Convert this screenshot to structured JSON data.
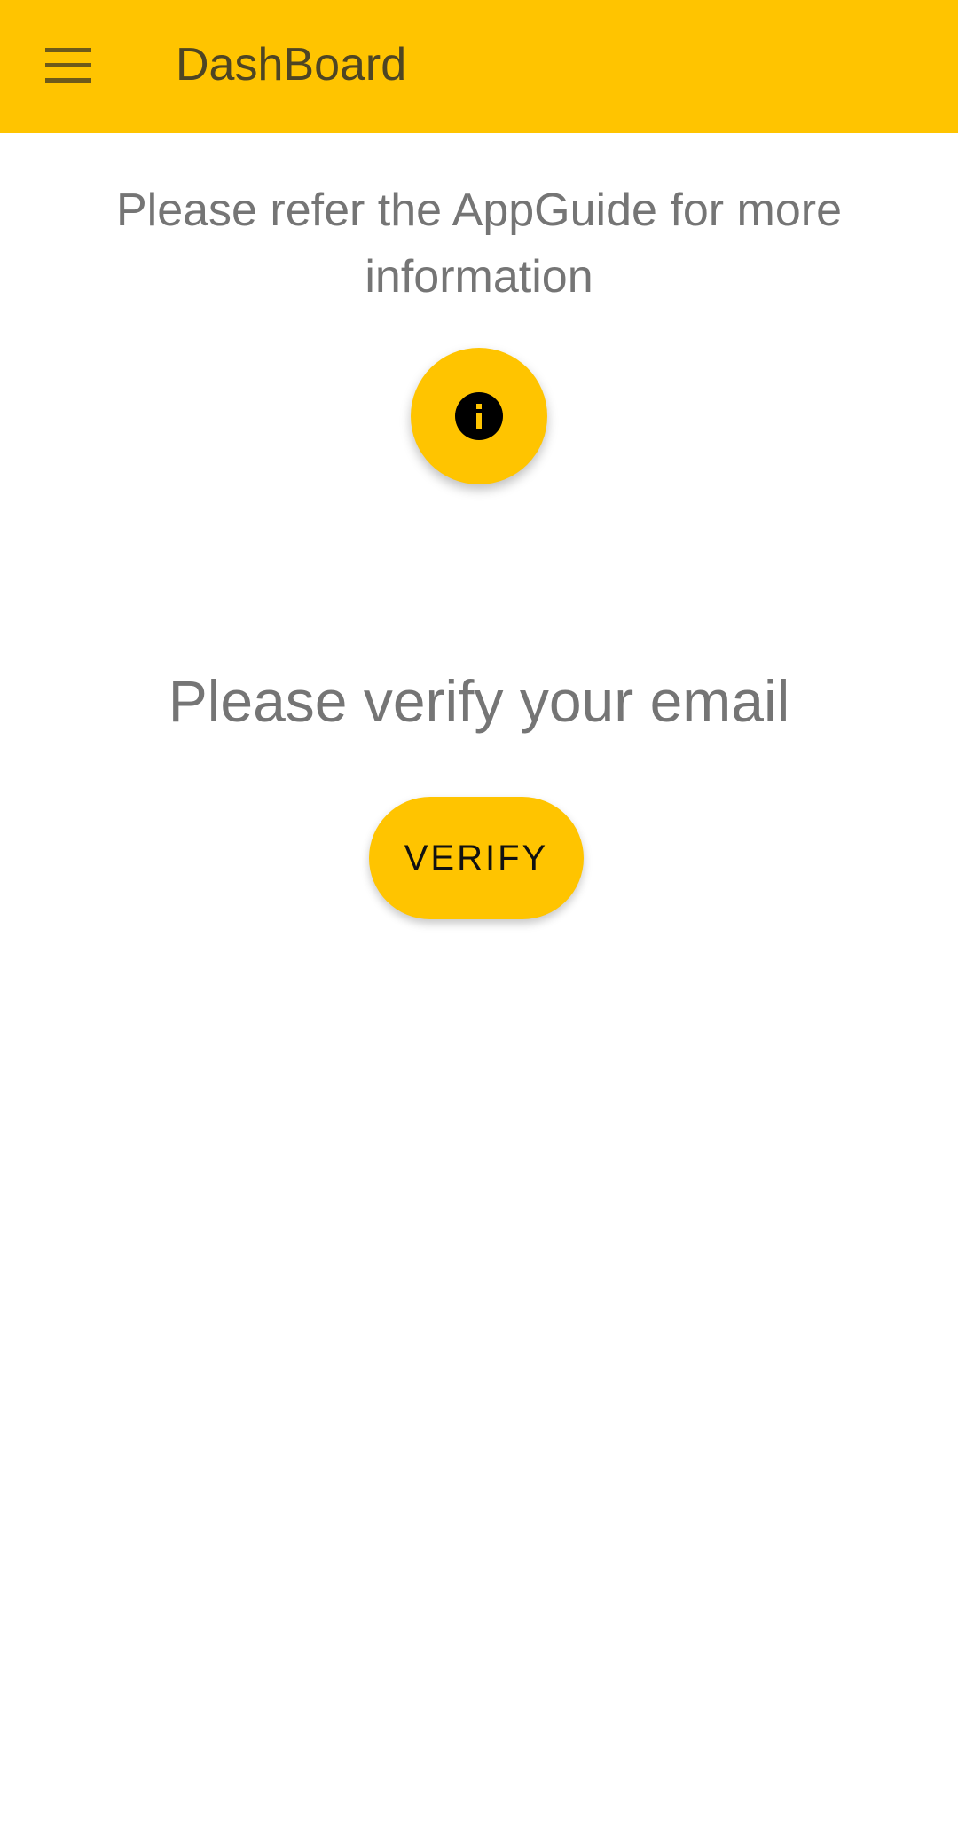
{
  "header": {
    "title": "DashBoard",
    "menu_icon": "menu-icon",
    "color": "#FFC400"
  },
  "main": {
    "info_message": "Please refer the AppGuide for more information",
    "info_icon": "info-icon",
    "verify_message": "Please verify your email",
    "verify_button_label": "VERIFY"
  }
}
